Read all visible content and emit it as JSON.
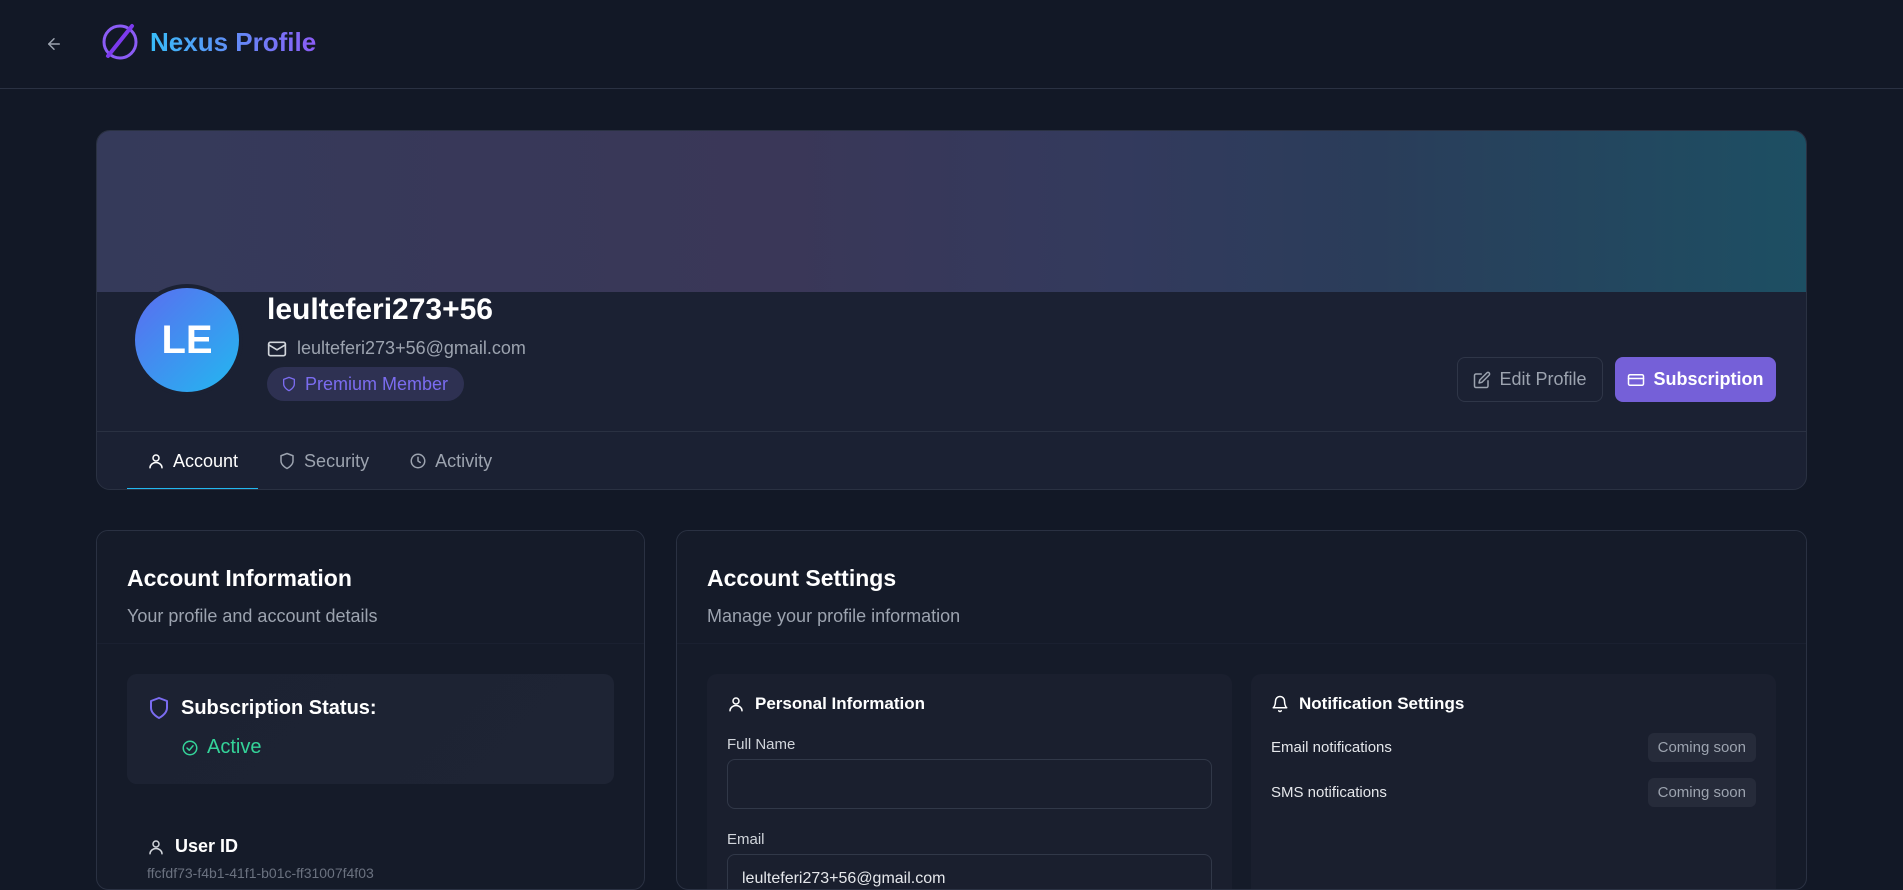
{
  "header": {
    "app_title": "Nexus Profile"
  },
  "profile": {
    "initials": "LE",
    "username": "leulteferi273+56",
    "email": "leulteferi273+56@gmail.com",
    "membership_badge": "Premium Member",
    "edit_label": "Edit Profile",
    "subscription_label": "Subscription"
  },
  "tabs": [
    {
      "label": "Account",
      "icon": "user-icon",
      "active": true
    },
    {
      "label": "Security",
      "icon": "shield-icon",
      "active": false
    },
    {
      "label": "Activity",
      "icon": "clock-icon",
      "active": false
    }
  ],
  "account_info": {
    "title": "Account Information",
    "subtitle": "Your profile and account details",
    "subscription_status_label": "Subscription Status:",
    "subscription_status_value": "Active",
    "user_id_label": "User ID",
    "user_id_value": "ffcfdf73-f4b1-41f1-b01c-ff31007f4f03"
  },
  "account_settings": {
    "title": "Account Settings",
    "subtitle": "Manage your profile information",
    "personal": {
      "title": "Personal Information",
      "full_name_label": "Full Name",
      "full_name_value": "",
      "email_label": "Email",
      "email_value": "leulteferi273+56@gmail.com"
    },
    "notifications": {
      "title": "Notification Settings",
      "items": [
        {
          "label": "Email notifications",
          "status": "Coming soon"
        },
        {
          "label": "SMS notifications",
          "status": "Coming soon"
        }
      ]
    }
  },
  "colors": {
    "accent": "#7560d8",
    "active_tab": "#22b8f0",
    "status_active": "#34d399",
    "background": "#121826"
  }
}
